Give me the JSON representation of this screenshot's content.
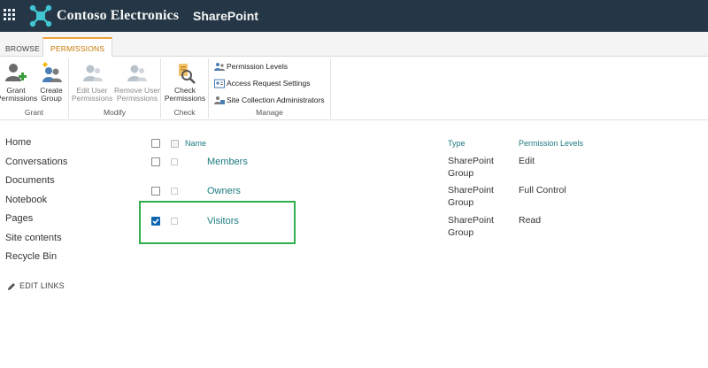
{
  "suitebar": {
    "brand": "Contoso Electronics",
    "app_name": "SharePoint",
    "waffle_icon": "app-launcher-icon",
    "logo_icon": "contoso-logo-icon",
    "background": "#253746"
  },
  "ribbon": {
    "tabs": [
      {
        "label": "BROWSE",
        "active": false
      },
      {
        "label": "PERMISSIONS",
        "active": true
      }
    ],
    "accent": "#f0a23a",
    "groups": [
      {
        "label": "Grant",
        "buttons": [
          {
            "label_1": "Grant",
            "label_2": "Permissions",
            "icon": "grant-permissions-icon",
            "enabled": true
          },
          {
            "label_1": "Create",
            "label_2": "Group",
            "icon": "create-group-icon",
            "enabled": true
          }
        ]
      },
      {
        "label": "Modify",
        "buttons": [
          {
            "label_1": "Edit User",
            "label_2": "Permissions",
            "icon": "edit-user-permissions-icon",
            "enabled": false
          },
          {
            "label_1": "Remove User",
            "label_2": "Permissions",
            "icon": "remove-user-permissions-icon",
            "enabled": false
          }
        ]
      },
      {
        "label": "Check",
        "buttons": [
          {
            "label_1": "Check",
            "label_2": "Permissions",
            "icon": "check-permissions-icon",
            "enabled": true
          }
        ]
      },
      {
        "label": "Manage",
        "items": [
          {
            "label": "Permission Levels",
            "icon": "permission-levels-icon"
          },
          {
            "label": "Access Request Settings",
            "icon": "access-request-settings-icon"
          },
          {
            "label": "Site Collection Administrators",
            "icon": "site-collection-admins-icon"
          }
        ]
      }
    ]
  },
  "leftnav": {
    "items": [
      "Home",
      "Conversations",
      "Documents",
      "Notebook",
      "Pages",
      "Site contents",
      "Recycle Bin"
    ],
    "edit_links": "EDIT LINKS"
  },
  "list": {
    "columns": {
      "name": "Name",
      "type": "Type",
      "permission_levels": "Permission Levels"
    },
    "rows": [
      {
        "name": "Members",
        "type": "SharePoint Group",
        "permission": "Edit",
        "checked": false
      },
      {
        "name": "Owners",
        "type": "SharePoint Group",
        "permission": "Full Control",
        "checked": false
      },
      {
        "name": "Visitors",
        "type": "SharePoint Group",
        "permission": "Read",
        "checked": true
      }
    ],
    "link_color": "#1e7a80",
    "checked_color": "#0a64b0",
    "highlight_color": "#2fae4b"
  }
}
